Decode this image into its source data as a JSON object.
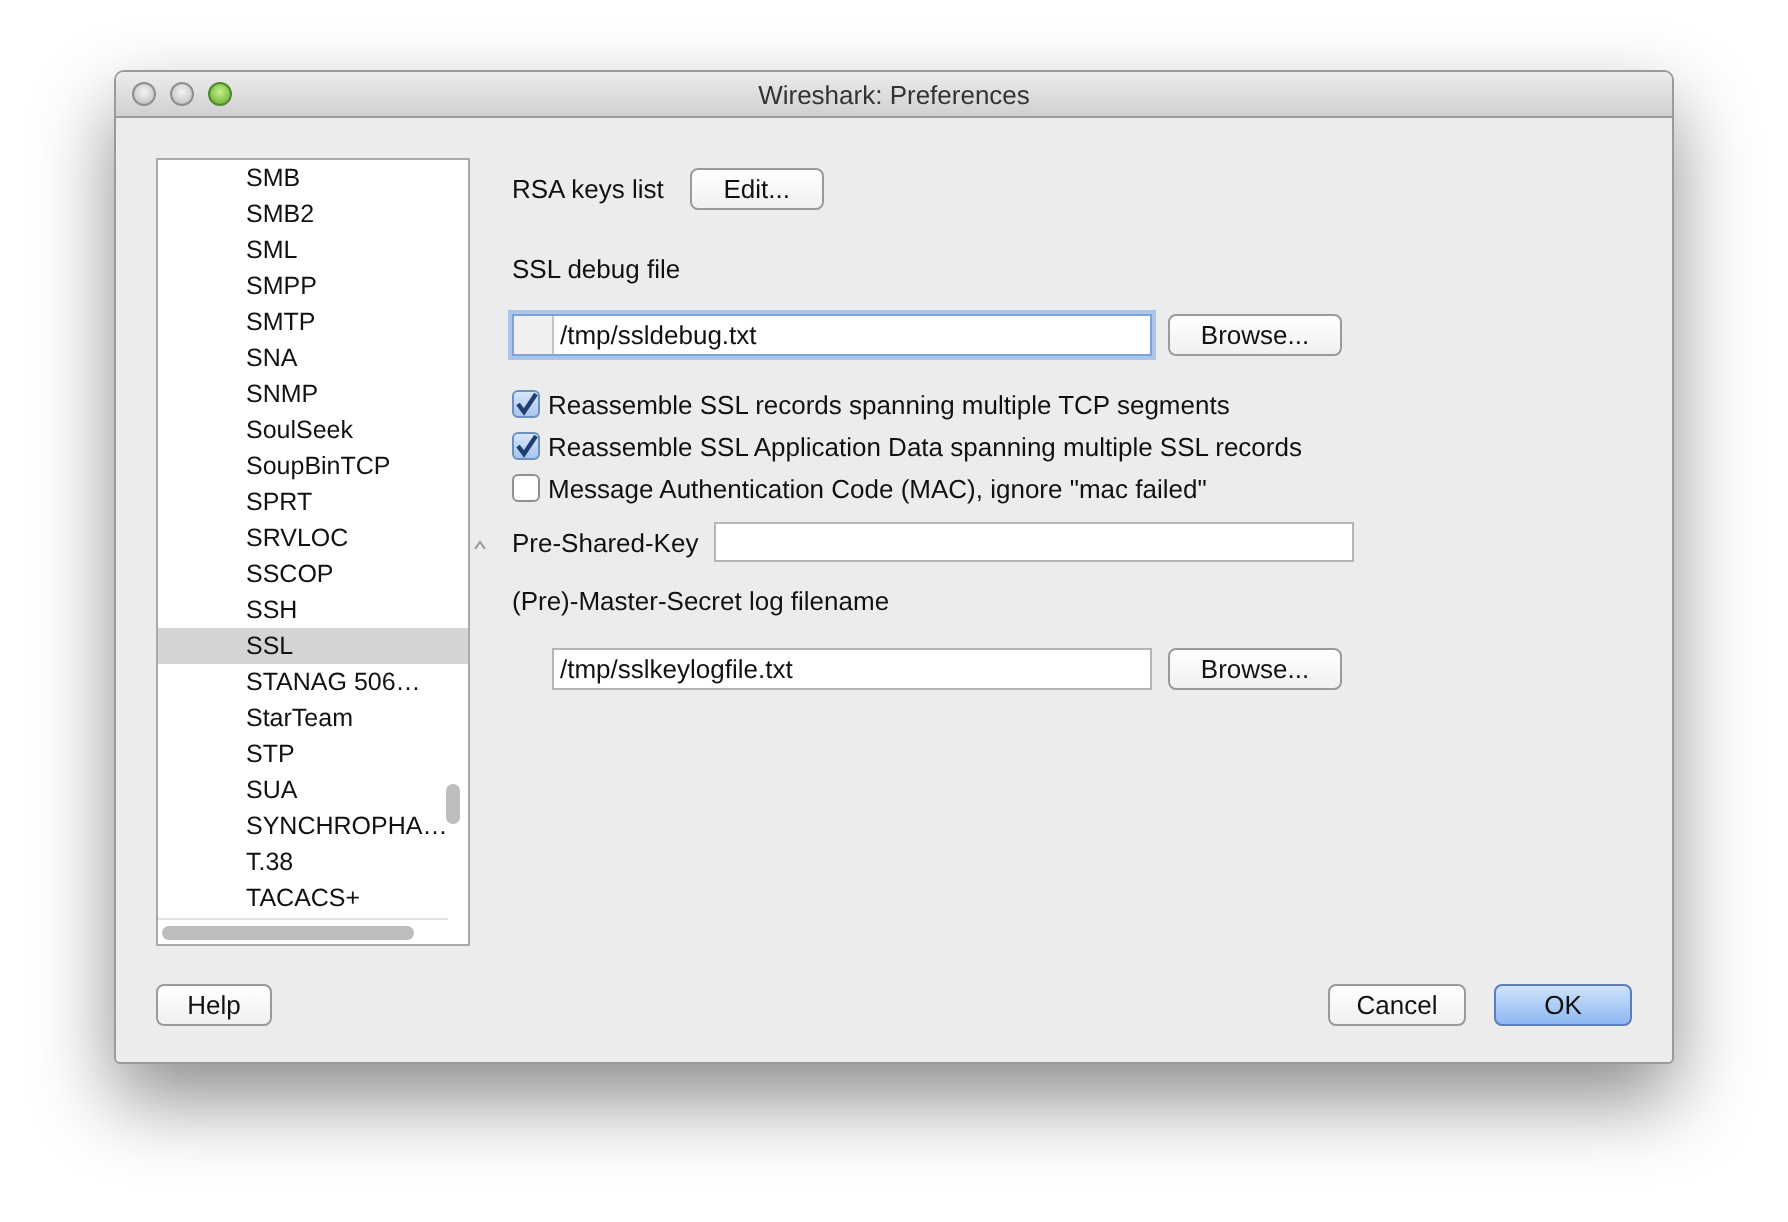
{
  "window": {
    "title": "Wireshark: Preferences"
  },
  "protocols": [
    {
      "label": "SMB",
      "selected": false
    },
    {
      "label": "SMB2",
      "selected": false
    },
    {
      "label": "SML",
      "selected": false
    },
    {
      "label": "SMPP",
      "selected": false
    },
    {
      "label": "SMTP",
      "selected": false
    },
    {
      "label": "SNA",
      "selected": false
    },
    {
      "label": "SNMP",
      "selected": false
    },
    {
      "label": "SoulSeek",
      "selected": false
    },
    {
      "label": "SoupBinTCP",
      "selected": false
    },
    {
      "label": "SPRT",
      "selected": false
    },
    {
      "label": "SRVLOC",
      "selected": false
    },
    {
      "label": "SSCOP",
      "selected": false
    },
    {
      "label": "SSH",
      "selected": false
    },
    {
      "label": "SSL",
      "selected": true
    },
    {
      "label": "STANAG 506…",
      "selected": false
    },
    {
      "label": "StarTeam",
      "selected": false
    },
    {
      "label": "STP",
      "selected": false
    },
    {
      "label": "SUA",
      "selected": false
    },
    {
      "label": "SYNCHROPHA…",
      "selected": false
    },
    {
      "label": "T.38",
      "selected": false
    },
    {
      "label": "TACACS+",
      "selected": false
    }
  ],
  "rsa_keys": {
    "label": "RSA keys list",
    "button": "Edit..."
  },
  "debug_file": {
    "label": "SSL debug file",
    "value": "/tmp/ssldebug.txt",
    "focused": true,
    "button": "Browse..."
  },
  "options": [
    {
      "label": "Reassemble SSL records spanning multiple TCP segments",
      "checked": true
    },
    {
      "label": "Reassemble SSL Application Data spanning multiple SSL records",
      "checked": true
    },
    {
      "label": "Message Authentication Code (MAC), ignore \"mac failed\"",
      "checked": false
    }
  ],
  "pre_shared_key": {
    "label": "Pre-Shared-Key"
  },
  "master_secret": {
    "label": "(Pre)-Master-Secret log filename",
    "value": "/tmp/sslkeylogfile.txt",
    "focused": false,
    "button": "Browse..."
  },
  "buttons": [
    {
      "label": "Help",
      "kind": "help"
    },
    {
      "label": "Cancel",
      "kind": "cancel"
    },
    {
      "label": "OK",
      "kind": "default"
    }
  ]
}
